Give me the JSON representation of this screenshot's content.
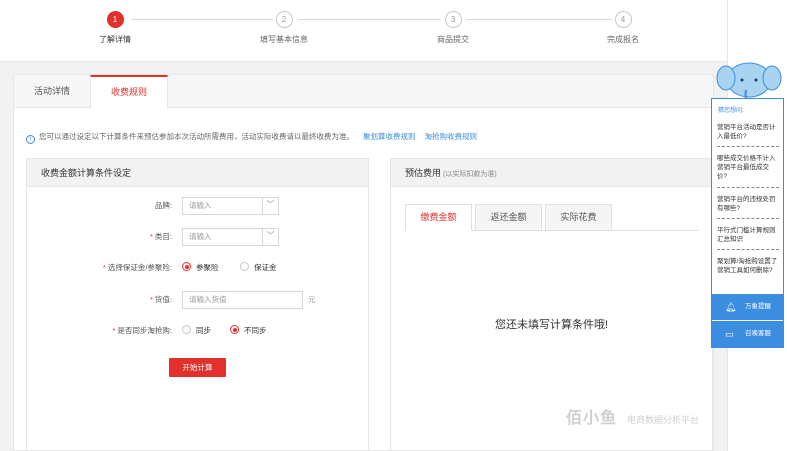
{
  "steps": [
    {
      "num": "1",
      "label": "了解详情",
      "active": true
    },
    {
      "num": "2",
      "label": "填写基本信息",
      "active": false
    },
    {
      "num": "3",
      "label": "商品提交",
      "active": false
    },
    {
      "num": "4",
      "label": "完成报名",
      "active": false
    }
  ],
  "tabs": [
    "活动详情",
    "收费规则"
  ],
  "notice": {
    "text": "您可以通过设定以下计算条件来预估参加本次活动所需费用，活动实际收费请以最终收费为准。",
    "link1": "聚划算收费规则",
    "link2": "淘抢购收费规则"
  },
  "calc": {
    "title": "收费金额计算条件设定",
    "brand_label": "品牌:",
    "brand_placeholder": "请输入",
    "category_label": "类目:",
    "category_placeholder": "请输入",
    "deposit_label": "选择保证金/参聚险:",
    "deposit_opt1": "参聚险",
    "deposit_opt2": "保证金",
    "value_label": "货值:",
    "value_placeholder": "请输入货值",
    "value_unit": "元",
    "sync_label": "是否同步淘抢购:",
    "sync_opt1": "同步",
    "sync_opt2": "不同步",
    "submit": "开始计算"
  },
  "estimate": {
    "title": "预估费用",
    "note": "(以实际扣款为准)",
    "tabs": [
      "缴费金额",
      "返还金额",
      "实际花费"
    ],
    "empty": "您还未填写计算条件哦!"
  },
  "widget": {
    "guess": "猜您想问:",
    "questions": [
      "营销平台活动是否计入最低价?",
      "哪些成交价格不计入营销平台最低成交价?",
      "营销平台的违规处罚有哪些?",
      "平行式门槛计算规则汇总知识",
      "聚划算/淘抢购设置了营销工具如何删除?"
    ],
    "remind": "万象提醒",
    "service": "召唤客服"
  },
  "watermark": {
    "logo": "佰小鱼",
    "sub": "电商数据分析平台"
  },
  "colors": {
    "accent": "#e2312c",
    "link": "#3b8de0"
  }
}
